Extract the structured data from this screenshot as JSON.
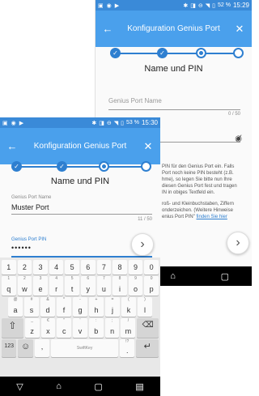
{
  "back_phone": {
    "status": {
      "battery": "52 %",
      "time": "15:29"
    },
    "app_title": "Konfiguration Genius Port",
    "heading": "Name und PIN",
    "name_field": {
      "label": "Genius Port Name",
      "counter": "0 / 50"
    },
    "hint_lines": [
      "PIN für den Genius Port ein. Falls",
      "Port noch keine PIN besteht (z.B.",
      "hme), so legen Sie bitte nun Ihre",
      "diesen Genius Port fest und tragen",
      "IN in obiges Textfeld ein."
    ],
    "hint2_lines": [
      "roß- und Kleinbuchstaben, Ziffern",
      "onderzeichen. (Weitere Hinweise",
      "enius Port PIN\""
    ],
    "hint_link": "finden Sie hier"
  },
  "front_phone": {
    "status": {
      "battery": "53 %",
      "time": "15:30"
    },
    "app_title": "Konfiguration Genius Port",
    "heading": "Name und PIN",
    "name_field": {
      "label": "Genius Port Name",
      "value": "Muster Port",
      "counter": "11 / 50"
    },
    "pin_field": {
      "label": "Genius Port PIN",
      "value": "••••••"
    },
    "keyboard": {
      "row1": [
        "1",
        "2",
        "3",
        "4",
        "5",
        "6",
        "7",
        "8",
        "9",
        "0"
      ],
      "row2": [
        {
          "sup": "1",
          "main": "q"
        },
        {
          "sup": "2",
          "main": "w"
        },
        {
          "sup": "3",
          "main": "e"
        },
        {
          "sup": "4",
          "main": "r"
        },
        {
          "sup": "5",
          "main": "t"
        },
        {
          "sup": "6",
          "main": "y"
        },
        {
          "sup": "7",
          "main": "u"
        },
        {
          "sup": "8",
          "main": "i"
        },
        {
          "sup": "9",
          "main": "o"
        },
        {
          "sup": "0",
          "main": "p"
        }
      ],
      "row3": [
        {
          "sup": "@",
          "main": "a"
        },
        {
          "sup": "#",
          "main": "s"
        },
        {
          "sup": "&",
          "main": "d"
        },
        {
          "sup": "*",
          "main": "f"
        },
        {
          "sup": "-",
          "main": "g"
        },
        {
          "sup": "+",
          "main": "h"
        },
        {
          "sup": "=",
          "main": "j"
        },
        {
          "sup": "(",
          "main": "k"
        },
        {
          "sup": ")",
          "main": "l"
        }
      ],
      "row4": [
        {
          "sup": "_",
          "main": "z"
        },
        {
          "sup": "€",
          "main": "x"
        },
        {
          "sup": "\"",
          "main": "c"
        },
        {
          "sup": "'",
          "main": "v"
        },
        {
          "sup": ":",
          "main": "b"
        },
        {
          "sup": ";",
          "main": "n"
        },
        {
          "sup": "/",
          "main": "m"
        }
      ],
      "num_key": "123",
      "emoji_key": "☺",
      "comma_key": ",",
      "space_label": "SwiftKey",
      "period_key": ".",
      "period_sup": "!?"
    }
  },
  "colors": {
    "primary": "#4aa0ec",
    "statusbar": "#3a8ad8",
    "accent": "#2e7fd0"
  }
}
